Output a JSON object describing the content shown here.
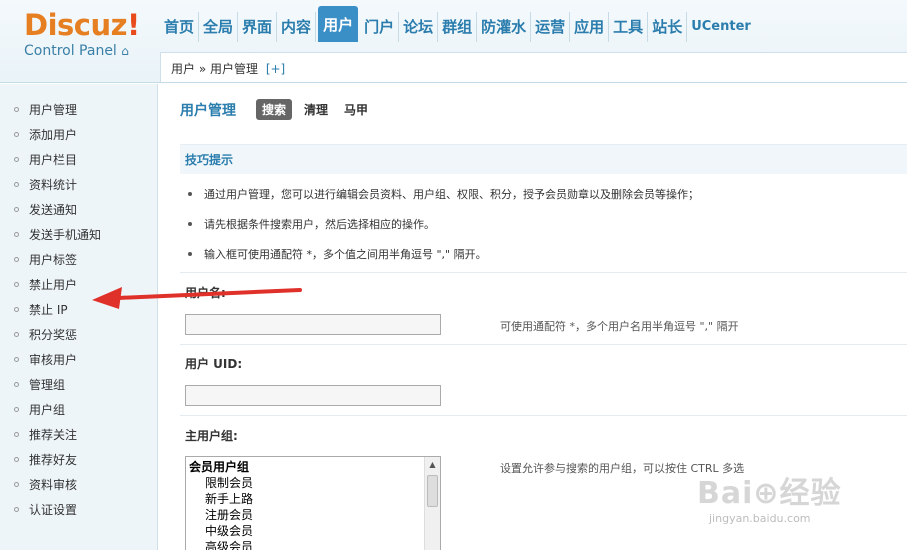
{
  "logo": {
    "brand": "Discuz",
    "mark": "!",
    "subtitle": "Control Panel",
    "home_glyph": "⌂"
  },
  "topnav": [
    {
      "label": "首页",
      "active": false
    },
    {
      "label": "全局",
      "active": false
    },
    {
      "label": "界面",
      "active": false
    },
    {
      "label": "内容",
      "active": false
    },
    {
      "label": "用户",
      "active": true
    },
    {
      "label": "门户",
      "active": false
    },
    {
      "label": "论坛",
      "active": false
    },
    {
      "label": "群组",
      "active": false
    },
    {
      "label": "防灌水",
      "active": false
    },
    {
      "label": "运营",
      "active": false
    },
    {
      "label": "应用",
      "active": false
    },
    {
      "label": "工具",
      "active": false
    },
    {
      "label": "站长",
      "active": false
    },
    {
      "label": "UCenter",
      "active": false
    }
  ],
  "breadcrumb": {
    "text": "用户 » 用户管理",
    "plus": "[+]"
  },
  "sidebar": {
    "items": [
      {
        "label": "用户管理"
      },
      {
        "label": "添加用户"
      },
      {
        "label": "用户栏目"
      },
      {
        "label": "资料统计"
      },
      {
        "label": "发送通知"
      },
      {
        "label": "发送手机通知"
      },
      {
        "label": "用户标签"
      },
      {
        "label": "禁止用户"
      },
      {
        "label": "禁止 IP"
      },
      {
        "label": "积分奖惩"
      },
      {
        "label": "审核用户"
      },
      {
        "label": "管理组"
      },
      {
        "label": "用户组"
      },
      {
        "label": "推荐关注"
      },
      {
        "label": "推荐好友"
      },
      {
        "label": "资料审核"
      },
      {
        "label": "认证设置"
      }
    ]
  },
  "main": {
    "title": "用户管理",
    "tabs": [
      {
        "label": "搜索",
        "active": true
      },
      {
        "label": "清理",
        "active": false
      },
      {
        "label": "马甲",
        "active": false
      }
    ],
    "tips": {
      "title": "技巧提示",
      "items": [
        "通过用户管理，您可以进行编辑会员资料、用户组、权限、积分，授予会员勋章以及删除会员等操作；",
        "请先根据条件搜索用户，然后选择相应的操作。",
        "输入框可使用通配符 *，多个值之间用半角逗号 \",\" 隔开。"
      ]
    },
    "username": {
      "label": "用户名:",
      "value": "",
      "hint": "可使用通配符 *，多个用户名用半角逗号 \",\" 隔开"
    },
    "uid": {
      "label": "用户 UID:",
      "value": ""
    },
    "group": {
      "label": "主用户组:",
      "hint": "设置允许参与搜索的用户组，可以按住 CTRL 多选",
      "optgroup": "会员用户组",
      "options": [
        "限制会员",
        "新手上路",
        "注册会员",
        "中级会员",
        "高级会员"
      ]
    }
  },
  "watermark": {
    "main": "Bai⊕经验",
    "sub": "jingyan.baidu.com"
  },
  "colors": {
    "accent": "#2b7dad",
    "active_tab": "#3b8fc7",
    "annotation_arrow": "#e0302a",
    "logo_orange": "#e67e22"
  }
}
